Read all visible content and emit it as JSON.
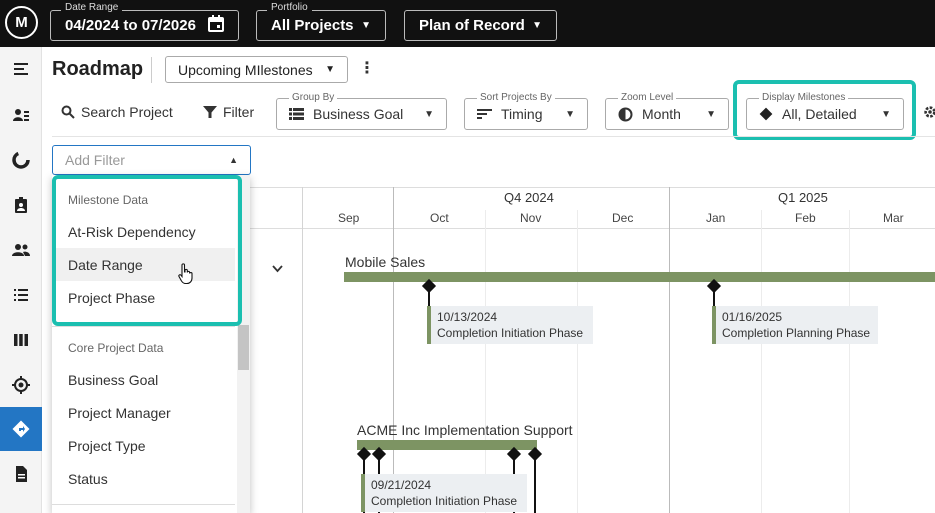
{
  "topbar": {
    "logo_text": "M",
    "date_range": {
      "label": "Date Range",
      "value": "04/2024 to 07/2026"
    },
    "portfolio": {
      "label": "Portfolio",
      "value": "All Projects"
    },
    "plan": {
      "value": "Plan of Record"
    }
  },
  "sidebar": {
    "icons": [
      "menu-icon",
      "people-list-icon",
      "chart-icon",
      "badge-icon",
      "group-icon",
      "list-icon",
      "columns-icon",
      "target-icon",
      "roadmap-icon",
      "document-icon"
    ],
    "active": "roadmap-icon"
  },
  "header": {
    "title": "Roadmap",
    "view": "Upcoming MIlestones"
  },
  "toolbar": {
    "search_label": "Search Project",
    "filter_label": "Filter",
    "group_by": {
      "label": "Group By",
      "value": "Business Goal"
    },
    "sort_by": {
      "label": "Sort Projects By",
      "value": "Timing"
    },
    "zoom": {
      "label": "Zoom Level",
      "value": "Month"
    },
    "display_milestones": {
      "label": "Display Milestones",
      "value": "All, Detailed"
    }
  },
  "filter": {
    "placeholder": "Add Filter",
    "groups": [
      {
        "title": "Milestone Data",
        "items": [
          "At-Risk Dependency",
          "Date Range",
          "Project Phase"
        ]
      },
      {
        "title": "Core Project Data",
        "items": [
          "Business Goal",
          "Project Manager",
          "Project Type",
          "Status"
        ]
      }
    ],
    "hovered_item": "Date Range"
  },
  "timeline": {
    "quarters": [
      "Q4 2024",
      "Q1 2025"
    ],
    "months": [
      "Sep",
      "Oct",
      "Nov",
      "Dec",
      "Jan",
      "Feb",
      "Mar"
    ],
    "projects": [
      {
        "name": "Mobile Sales",
        "milestones": [
          {
            "date": "10/13/2024",
            "label": "Completion Initiation Phase"
          },
          {
            "date": "01/16/2025",
            "label": "Completion Planning Phase"
          }
        ]
      },
      {
        "name": "ACME Inc Implementation Support",
        "milestones": [
          {
            "date": "09/21/2024",
            "label": "Completion Initiation Phase"
          }
        ]
      }
    ]
  },
  "colors": {
    "accent_highlight": "#1bbfb0",
    "active_nav": "#2376c4",
    "bar": "#7d9463",
    "topbar": "#111111"
  }
}
